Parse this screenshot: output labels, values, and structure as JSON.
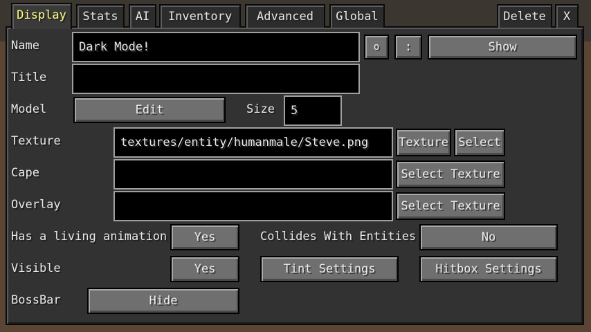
{
  "tabs": [
    {
      "label": "Display"
    },
    {
      "label": "Stats"
    },
    {
      "label": "AI"
    },
    {
      "label": "Inventory"
    },
    {
      "label": "Advanced"
    },
    {
      "label": "Global"
    }
  ],
  "window_buttons": {
    "delete": "Delete",
    "close": "X"
  },
  "name": {
    "label": "Name",
    "value": "Dark Mode!",
    "btn_o": "o",
    "btn_dots": ":",
    "show_label": "Show"
  },
  "title": {
    "label": "Title",
    "value": ""
  },
  "model": {
    "label": "Model",
    "edit_label": "Edit",
    "size_label": "Size",
    "size_value": "5"
  },
  "texture": {
    "label": "Texture",
    "value": "textures/entity/humanmale/Steve.png",
    "texture_btn": "Texture",
    "select_btn": "Select"
  },
  "cape": {
    "label": "Cape",
    "value": "",
    "select_texture": "Select Texture"
  },
  "overlay": {
    "label": "Overlay",
    "value": "",
    "select_texture": "Select Texture"
  },
  "living_animation": {
    "label": "Has a living animation",
    "value": "Yes"
  },
  "collides": {
    "label": "Collides With Entities",
    "value": "No"
  },
  "visible": {
    "label": "Visible",
    "value": "Yes"
  },
  "tint_settings": "Tint Settings",
  "hitbox_settings": "Hitbox Settings",
  "bossbar": {
    "label": "BossBar",
    "value": "Hide"
  }
}
